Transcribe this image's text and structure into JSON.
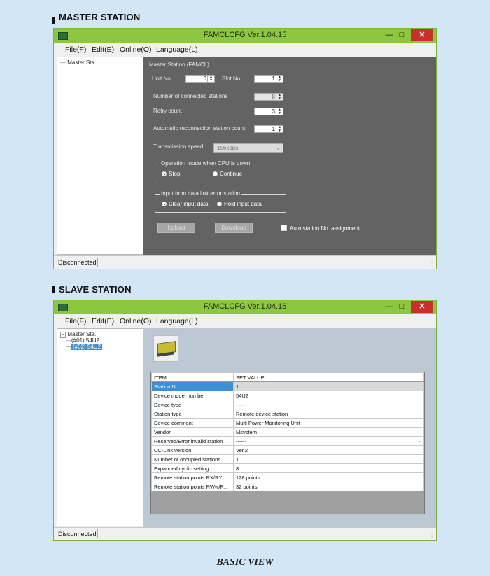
{
  "master_heading": "MASTER STATION",
  "slave_heading": "SLAVE STATION",
  "caption": "BASIC VIEW",
  "master_window": {
    "title": "FAMCLCFG Ver.1.04.15",
    "menu": [
      "File(F)",
      "Edit(E)",
      "Online(O)",
      "Language(L)"
    ],
    "tree": [
      "Master Sta."
    ],
    "panel_title": "Master Station (FAMCL)",
    "unit_no_label": "Unit No.",
    "unit_no_value": "0",
    "slot_no_label": "Slot No.",
    "slot_no_value": "1",
    "connected_label": "Number of connected stations",
    "connected_value": "8",
    "retry_label": "Retry count",
    "retry_value": "3",
    "reconnect_label": "Automatic reconnection station count",
    "reconnect_value": "1",
    "speed_label": "Transmission speed",
    "speed_value": "156kbps",
    "cpu_group_title": "Operation mode when CPU is down",
    "cpu_opt_stop": "Stop",
    "cpu_opt_continue": "Continue",
    "input_group_title": "Input from data link error station",
    "input_opt_clear": "Clear input data",
    "input_opt_hold": "Hold input data",
    "upload_label": "Upload",
    "download_label": "Download",
    "auto_assign_label": "Auto station No. assignment",
    "status": "Disconnected"
  },
  "slave_window": {
    "title": "FAMCLCFG Ver.1.04.16",
    "menu": [
      "File(F)",
      "Edit(E)",
      "Online(O)",
      "Language(L)"
    ],
    "tree": [
      "Master Sta.",
      "(#01) 54U2",
      "(#02) 54U2"
    ],
    "table_headers": [
      "ITEM",
      "SET VALUE"
    ],
    "rows": [
      {
        "item": "Station No.",
        "value": "1"
      },
      {
        "item": "Device model number",
        "value": "54U2"
      },
      {
        "item": "Device type",
        "value": "------"
      },
      {
        "item": "Station type",
        "value": "Remote device station"
      },
      {
        "item": "Device comment",
        "value": "Multi Power Monitoring Unit"
      },
      {
        "item": "Vendor",
        "value": "Msystem"
      },
      {
        "item": "Reserved/Error invalid station",
        "value": "------"
      },
      {
        "item": "CC-Link version",
        "value": "Ver.2"
      },
      {
        "item": "Number of occupied stations",
        "value": "1"
      },
      {
        "item": "Expanded cyclic setting",
        "value": "8"
      },
      {
        "item": "Remote station points RX/RY",
        "value": "128 points"
      },
      {
        "item": "Remote station points RWw/R..",
        "value": "32 points"
      }
    ],
    "status": "Disconnected"
  },
  "colors": {
    "titlebar": "#8dc63f",
    "page_background": "#d3e6f5",
    "master_panel": "#636363",
    "selection": "#3d8fd6",
    "close_button": "#c9302c"
  },
  "icons": [
    "app-icon",
    "minimize-icon",
    "maximize-icon",
    "close-icon",
    "spin-arrows-icon",
    "dropdown-arrow-icon",
    "device-image"
  ]
}
